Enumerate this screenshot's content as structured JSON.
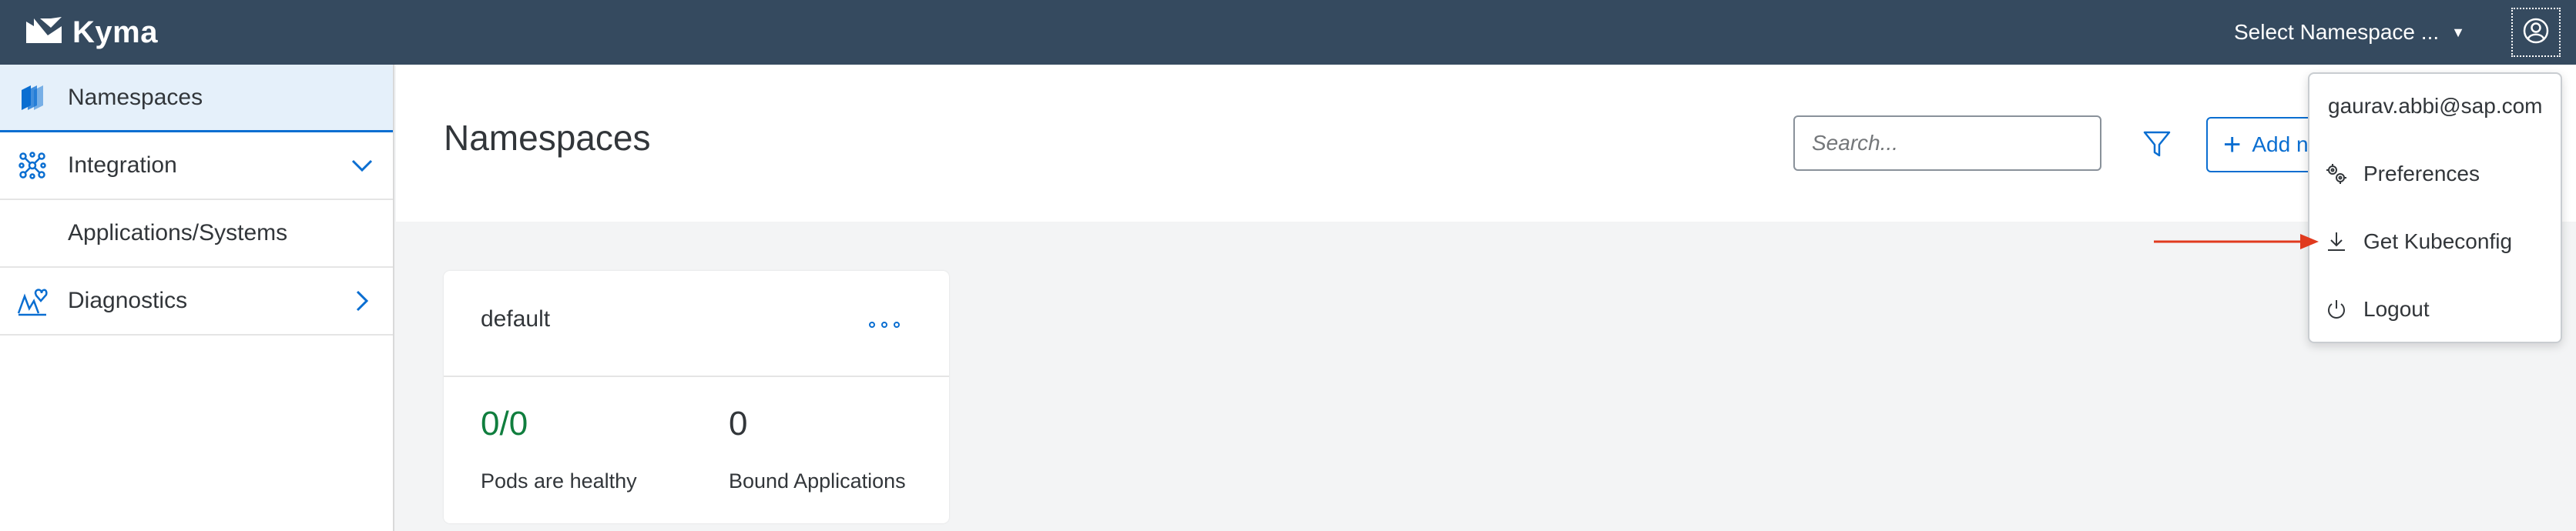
{
  "shellbar": {
    "app_name": "Kyma",
    "namespace_select": "Select Namespace ...",
    "user_icon": "user-circle-icon"
  },
  "sidebar": {
    "items": [
      {
        "label": "Namespaces",
        "icon": "namespaces-icon",
        "active": true
      },
      {
        "label": "Integration",
        "icon": "integration-icon",
        "expanded": true
      },
      {
        "label": "Applications/Systems",
        "sub": true
      },
      {
        "label": "Diagnostics",
        "icon": "diagnostics-icon",
        "expanded": false
      }
    ]
  },
  "header": {
    "title": "Namespaces",
    "search_placeholder": "Search...",
    "add_label": "Add new namespace"
  },
  "card": {
    "name": "default",
    "pods_value": "0/0",
    "pods_label": "Pods are healthy",
    "apps_value": "0",
    "apps_label": "Bound Applications"
  },
  "user_menu": {
    "email": "gaurav.abbi@sap.com",
    "items": [
      {
        "label": "Preferences",
        "icon": "gears-icon"
      },
      {
        "label": "Get Kubeconfig",
        "icon": "download-icon"
      },
      {
        "label": "Logout",
        "icon": "power-icon"
      }
    ]
  },
  "colors": {
    "shellbar": "#354a5f",
    "accent": "#0a6ed1",
    "success": "#107e3e",
    "annotation_arrow": "#e03a1e"
  }
}
